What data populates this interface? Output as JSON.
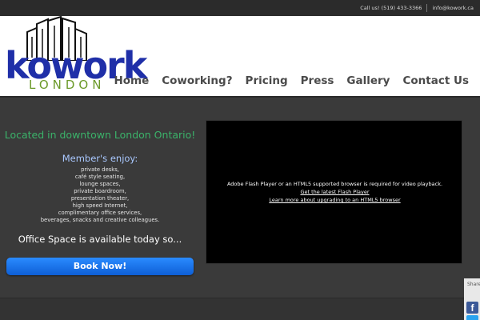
{
  "topbar": {
    "phone": "Call us! (519) 433-3366",
    "email": "info@kowork.ca"
  },
  "logo": {
    "word": "kowork",
    "sub": "LONDON"
  },
  "nav": {
    "items": [
      "Home",
      "Coworking?",
      "Pricing",
      "Press",
      "Gallery",
      "Contact Us"
    ]
  },
  "intro": {
    "location": "Located in downtown London Ontario!",
    "enjoy": "Member's enjoy:",
    "perks": [
      "private desks,",
      "café style seating,",
      "lounge spaces,",
      "private boardroom,",
      "presentation theater,",
      "high speed Internet,",
      "complimentary office services,",
      "beverages, snacks and creative colleagues."
    ],
    "office": "Office Space is available today so...",
    "book_label": "Book Now!"
  },
  "video": {
    "message": "Adobe Flash Player or an HTML5 supported browser is required for video playback.",
    "link1": "Get the latest Flash Player",
    "link2": "Learn more about upgrading to an HTML5 browser"
  },
  "share": {
    "label": "Share",
    "facebook_letter": "f"
  },
  "colors": {
    "brand_blue": "#1f2fa8",
    "brand_green": "#6c9a2a",
    "location_green": "#3bb36a",
    "button_blue": "#1a75ee",
    "background": "#3a3a3a"
  },
  "icons": [
    "buildings-logo-icon",
    "facebook-icon",
    "twitter-icon"
  ]
}
